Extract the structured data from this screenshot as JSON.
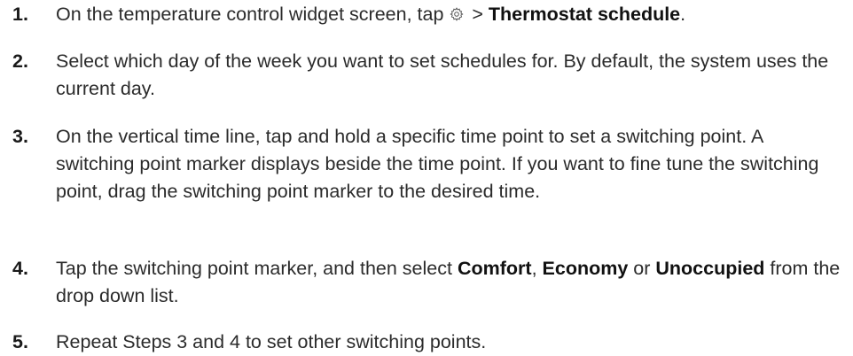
{
  "steps": [
    {
      "number": "1.",
      "before": "On the temperature control widget screen, tap ",
      "icon": "gear-icon",
      "middle": " > ",
      "bold": "Thermostat schedule",
      "after": "."
    },
    {
      "number": "2.",
      "text": "Select which day of the week you want to set schedules for. By default, the system uses the current day."
    },
    {
      "number": "3.",
      "text": "On the vertical time line, tap and hold a specific time point to set a switching point. A switching point marker displays beside the time point. If you want to fine tune the switching point, drag the switching point marker to the desired time."
    },
    {
      "number": "4.",
      "before": "Tap the switching point marker, and then select ",
      "bold1": "Comfort",
      "sep1": ", ",
      "bold2": "Economy",
      "sep2": " or ",
      "bold3": "Unoccupied",
      "after": " from the drop down list."
    },
    {
      "number": "5.",
      "text": "Repeat Steps 3 and 4 to set other switching points."
    }
  ]
}
